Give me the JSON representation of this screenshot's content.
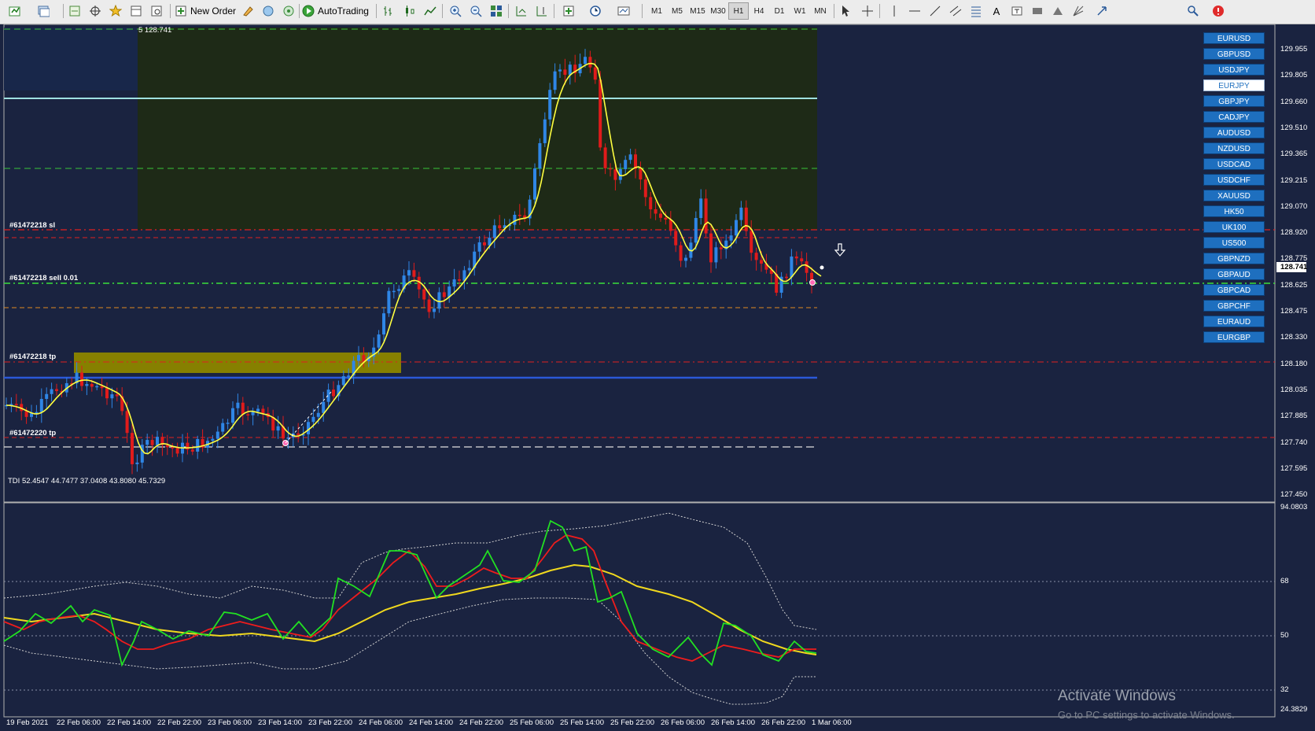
{
  "toolbar": {
    "new_order_label": "New Order",
    "autotrading_label": "AutoTrading",
    "timeframes": [
      "M1",
      "M5",
      "M15",
      "M30",
      "H1",
      "H4",
      "D1",
      "W1",
      "MN"
    ],
    "active_timeframe": "H1"
  },
  "price_label": "5 128.741",
  "tdi_label": "TDI 52.4547 44.7477 37.0408 43.8080 45.7329",
  "order_labels": {
    "sl": "#61472218 sl",
    "sell": "#61472218 sell 0.01",
    "tp1": "#61472218 tp",
    "tp2": "#61472220 tp"
  },
  "price_axis": [
    "129.955",
    "129.805",
    "129.660",
    "129.510",
    "129.365",
    "129.215",
    "129.070",
    "128.920",
    "128.775",
    "128.625",
    "128.475",
    "128.330",
    "128.180",
    "128.035",
    "127.885",
    "127.740",
    "127.595",
    "127.450"
  ],
  "current_price": "128.741",
  "tdi_axis": [
    "94.0803",
    "68",
    "50",
    "32",
    "24.3829"
  ],
  "time_axis": [
    "19 Feb 2021",
    "22 Feb 06:00",
    "22 Feb 14:00",
    "22 Feb 22:00",
    "23 Feb 06:00",
    "23 Feb 14:00",
    "23 Feb 22:00",
    "24 Feb 06:00",
    "24 Feb 14:00",
    "24 Feb 22:00",
    "25 Feb 06:00",
    "25 Feb 14:00",
    "25 Feb 22:00",
    "26 Feb 06:00",
    "26 Feb 14:00",
    "26 Feb 22:00",
    "1 Mar 06:00"
  ],
  "symbols": [
    "EURUSD",
    "GBPUSD",
    "USDJPY",
    "EURJPY",
    "GBPJPY",
    "CADJPY",
    "AUDUSD",
    "NZDUSD",
    "USDCAD",
    "USDCHF",
    "XAUUSD",
    "HK50",
    "UK100",
    "US500",
    "GBPNZD",
    "GBPAUD",
    "GBPCAD",
    "GBPCHF",
    "EURAUD",
    "EURGBP"
  ],
  "selected_symbol": "EURJPY",
  "watermark": {
    "title": "Activate Windows",
    "subtitle": "Go to PC settings to activate Windows."
  },
  "colors": {
    "background": "#1a2340",
    "bull": "#2f86e6",
    "bear": "#e01b1b",
    "ma": "#ffff40",
    "tdi_green": "#22e022",
    "tdi_red": "#ee1c1c",
    "tdi_yellow": "#f0d81e"
  }
}
